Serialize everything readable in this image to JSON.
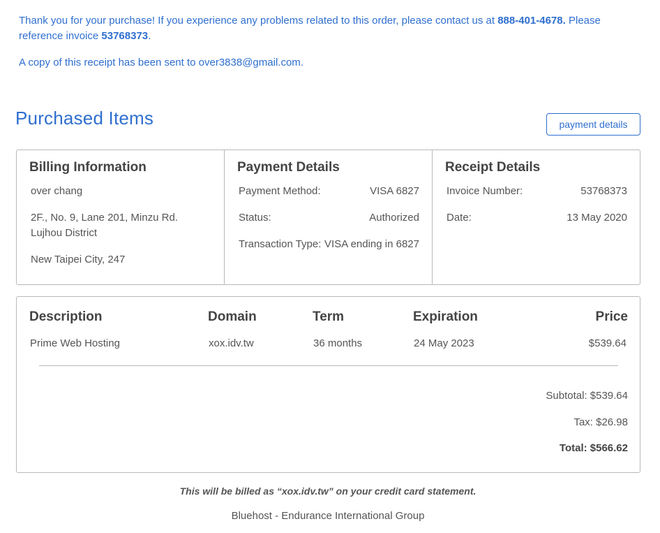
{
  "notice": {
    "text_before_phone": "Thank you for your purchase! If you experience any problems related to this order, please contact us at ",
    "phone": "888-401-4678.",
    "text_before_invoice": " Please reference invoice ",
    "invoice": "53768373",
    "period": ".",
    "copy_sent": "A copy of this receipt has been sent to over3838@gmail.com."
  },
  "purchased_items_title": "Purchased Items",
  "payment_details_button": "payment details",
  "billing": {
    "heading": "Billing Information",
    "name": "over chang",
    "address": "2F., No. 9, Lane 201, Minzu Rd. Lujhou District",
    "city": "New Taipei City, 247"
  },
  "payment": {
    "heading": "Payment Details",
    "rows": [
      {
        "label": "Payment Method:",
        "value": "VISA 6827"
      },
      {
        "label": "Status:",
        "value": "Authorized"
      },
      {
        "label": "Transaction Type:",
        "value": "VISA ending in 6827"
      }
    ]
  },
  "receipt": {
    "heading": "Receipt Details",
    "rows": [
      {
        "label": "Invoice Number:",
        "value": "53768373"
      },
      {
        "label": "Date:",
        "value": "13 May 2020"
      }
    ]
  },
  "items_table": {
    "headers": {
      "description": "Description",
      "domain": "Domain",
      "term": "Term",
      "expiration": "Expiration",
      "price": "Price"
    },
    "rows": [
      {
        "description": "Prime Web Hosting",
        "domain": "xox.idv.tw",
        "term": "36 months",
        "expiration": "24 May 2023",
        "price": "$539.64"
      }
    ]
  },
  "totals": {
    "subtotal": "Subtotal: $539.64",
    "tax": "Tax: $26.98",
    "total": "Total: $566.62"
  },
  "billed_note": "This will be billed as “xox.idv.tw” on your credit card statement.",
  "footer": "Bluehost - Endurance International Group"
}
